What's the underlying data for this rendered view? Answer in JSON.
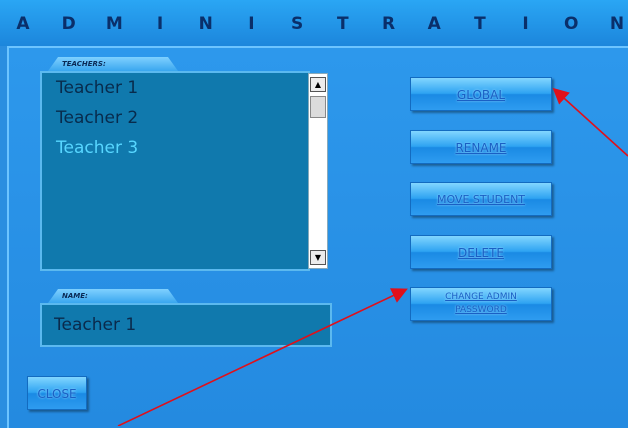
{
  "title_letters": [
    "A",
    "D",
    "M",
    "I",
    "N",
    "I",
    "S",
    "T",
    "R",
    "A",
    "T",
    "I",
    "O",
    "N"
  ],
  "teachers_tab": "TEACHERS:",
  "teachers": [
    {
      "name": "Teacher 1",
      "selected": false
    },
    {
      "name": "Teacher 2",
      "selected": false
    },
    {
      "name": "Teacher 3",
      "selected": true
    }
  ],
  "name_tab": "NAME:",
  "name_value": "Teacher 1",
  "buttons": {
    "global": "GLOBAL",
    "rename": "RENAME",
    "move_student": "MOVE STUDENT",
    "delete": "DELETE",
    "change_password_line1": "CHANGE ADMIN",
    "change_password_line2": "PASSWORD",
    "close": "CLOSE"
  },
  "colors": {
    "background": "#2a8ee0",
    "list_bg": "#1079ad",
    "selected_text": "#57d6ff",
    "annotation_arrow": "#e0101a"
  }
}
